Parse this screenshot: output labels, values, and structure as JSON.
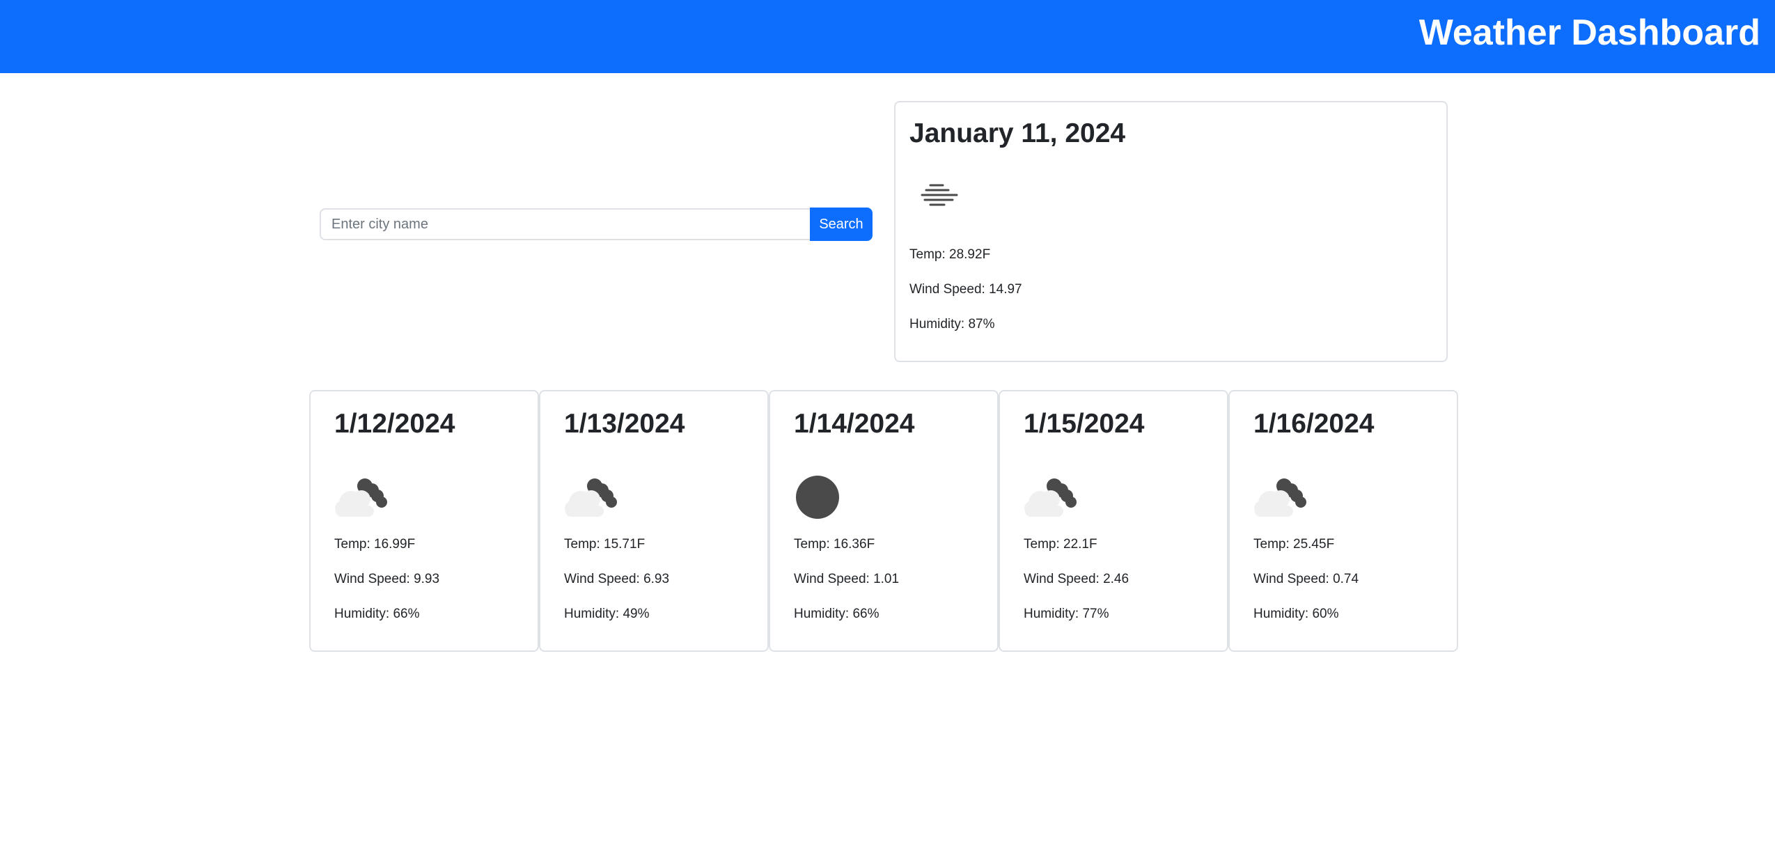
{
  "header": {
    "title": "Weather Dashboard"
  },
  "search": {
    "placeholder": "Enter city name",
    "value": "",
    "button_label": "Search"
  },
  "current": {
    "date": "January 11, 2024",
    "icon": "mist-icon",
    "temp": "Temp: 28.92F",
    "wind": "Wind Speed: 14.97",
    "humidity": "Humidity: 87%"
  },
  "forecast": [
    {
      "date": "1/12/2024",
      "icon": "partly-cloudy-night-icon",
      "temp": "Temp: 16.99F",
      "wind": "Wind Speed: 9.93",
      "humidity": "Humidity: 66%"
    },
    {
      "date": "1/13/2024",
      "icon": "partly-cloudy-night-icon",
      "temp": "Temp: 15.71F",
      "wind": "Wind Speed: 6.93",
      "humidity": "Humidity: 49%"
    },
    {
      "date": "1/14/2024",
      "icon": "clear-night-icon",
      "temp": "Temp: 16.36F",
      "wind": "Wind Speed: 1.01",
      "humidity": "Humidity: 66%"
    },
    {
      "date": "1/15/2024",
      "icon": "partly-cloudy-night-icon",
      "temp": "Temp: 22.1F",
      "wind": "Wind Speed: 2.46",
      "humidity": "Humidity: 77%"
    },
    {
      "date": "1/16/2024",
      "icon": "partly-cloudy-night-icon",
      "temp": "Temp: 25.45F",
      "wind": "Wind Speed: 0.74",
      "humidity": "Humidity: 60%"
    }
  ],
  "colors": {
    "header_bg": "#0d6efd",
    "button_bg": "#0d6efd",
    "card_border": "#dee2e6",
    "icon_dark": "#4a4a4a",
    "icon_cloud": "#f0f0f0"
  }
}
